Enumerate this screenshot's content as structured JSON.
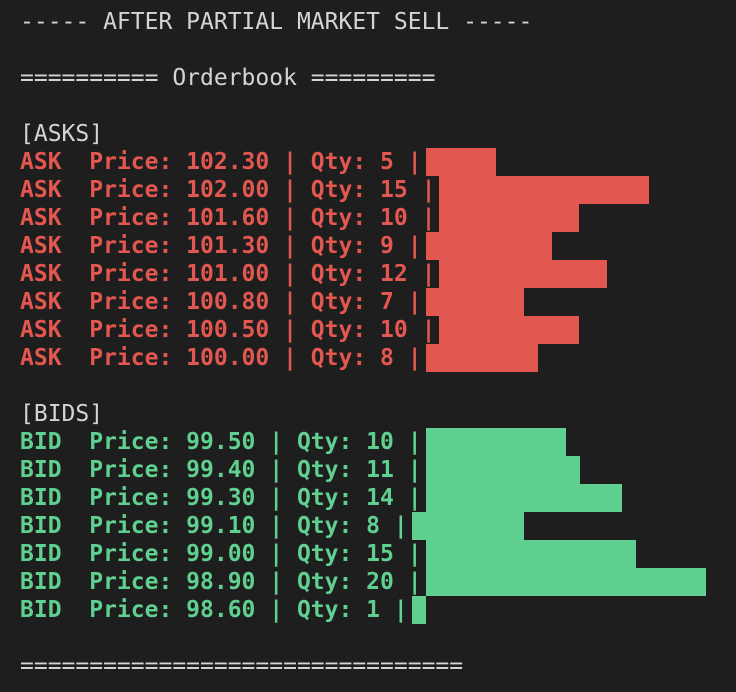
{
  "header_line": "----- AFTER PARTIAL MARKET SELL -----",
  "orderbook_title_line": "========== Orderbook =========",
  "asks_heading": "[ASKS]",
  "bids_heading": "[BIDS]",
  "footer_line": "================================",
  "colors": {
    "ask": "#e2574f",
    "bid": "#5fd08f",
    "background": "#1e1e1e",
    "text": "#d4d4d4"
  },
  "bar_scale_note_units": "qty",
  "asks": [
    {
      "text": "ASK  Price: 102.30 | Qty: 5 |",
      "qty": 5
    },
    {
      "text": "ASK  Price: 102.00 | Qty: 15 |",
      "qty": 15
    },
    {
      "text": "ASK  Price: 101.60 | Qty: 10 |",
      "qty": 10
    },
    {
      "text": "ASK  Price: 101.30 | Qty: 9 |",
      "qty": 9
    },
    {
      "text": "ASK  Price: 101.00 | Qty: 12 |",
      "qty": 12
    },
    {
      "text": "ASK  Price: 100.80 | Qty: 7 |",
      "qty": 7
    },
    {
      "text": "ASK  Price: 100.50 | Qty: 10 |",
      "qty": 10
    },
    {
      "text": "ASK  Price: 100.00 | Qty: 8 |",
      "qty": 8
    }
  ],
  "bids": [
    {
      "text": "BID  Price: 99.50 | Qty: 10 |",
      "qty": 10
    },
    {
      "text": "BID  Price: 99.40 | Qty: 11 |",
      "qty": 11
    },
    {
      "text": "BID  Price: 99.30 | Qty: 14 |",
      "qty": 14
    },
    {
      "text": "BID  Price: 99.10 | Qty: 8 |",
      "qty": 8
    },
    {
      "text": "BID  Price: 99.00 | Qty: 15 |",
      "qty": 15
    },
    {
      "text": "BID  Price: 98.90 | Qty: 20 |",
      "qty": 20
    },
    {
      "text": "BID  Price: 98.60 | Qty: 1 |",
      "qty": 1
    }
  ]
}
